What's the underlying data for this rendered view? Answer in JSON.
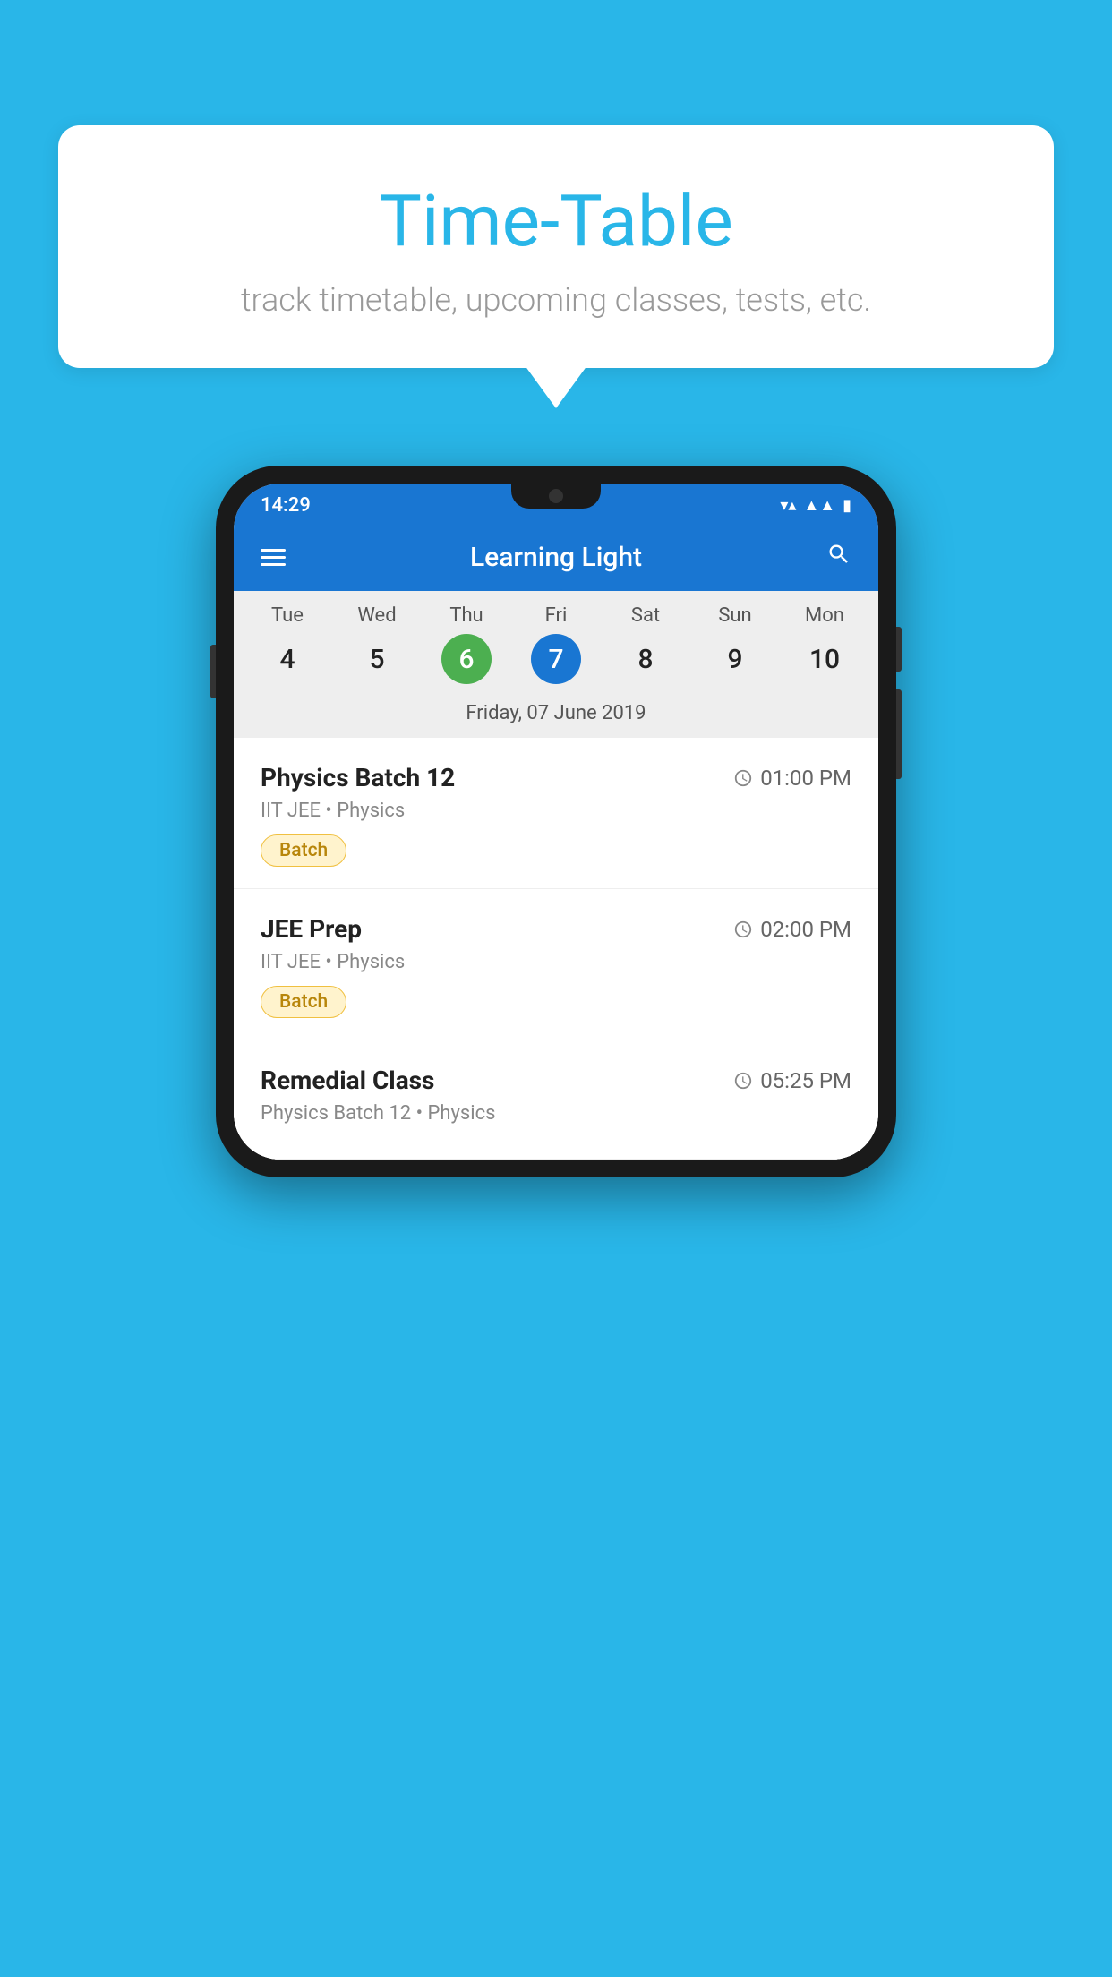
{
  "background_color": "#29b6e8",
  "speech_bubble": {
    "title": "Time-Table",
    "subtitle": "track timetable, upcoming classes, tests, etc."
  },
  "status_bar": {
    "time": "14:29"
  },
  "app_bar": {
    "title": "Learning Light"
  },
  "calendar": {
    "days": [
      {
        "name": "Tue",
        "number": "4",
        "state": "normal"
      },
      {
        "name": "Wed",
        "number": "5",
        "state": "normal"
      },
      {
        "name": "Thu",
        "number": "6",
        "state": "today"
      },
      {
        "name": "Fri",
        "number": "7",
        "state": "selected"
      },
      {
        "name": "Sat",
        "number": "8",
        "state": "normal"
      },
      {
        "name": "Sun",
        "number": "9",
        "state": "normal"
      },
      {
        "name": "Mon",
        "number": "10",
        "state": "normal"
      }
    ],
    "selected_date_label": "Friday, 07 June 2019"
  },
  "schedule": [
    {
      "title": "Physics Batch 12",
      "time": "01:00 PM",
      "subtitle": "IIT JEE • Physics",
      "badge": "Batch"
    },
    {
      "title": "JEE Prep",
      "time": "02:00 PM",
      "subtitle": "IIT JEE • Physics",
      "badge": "Batch"
    },
    {
      "title": "Remedial Class",
      "time": "05:25 PM",
      "subtitle": "Physics Batch 12 • Physics",
      "badge": null
    }
  ],
  "icons": {
    "hamburger": "☰",
    "search": "🔍",
    "clock": "🕐"
  }
}
